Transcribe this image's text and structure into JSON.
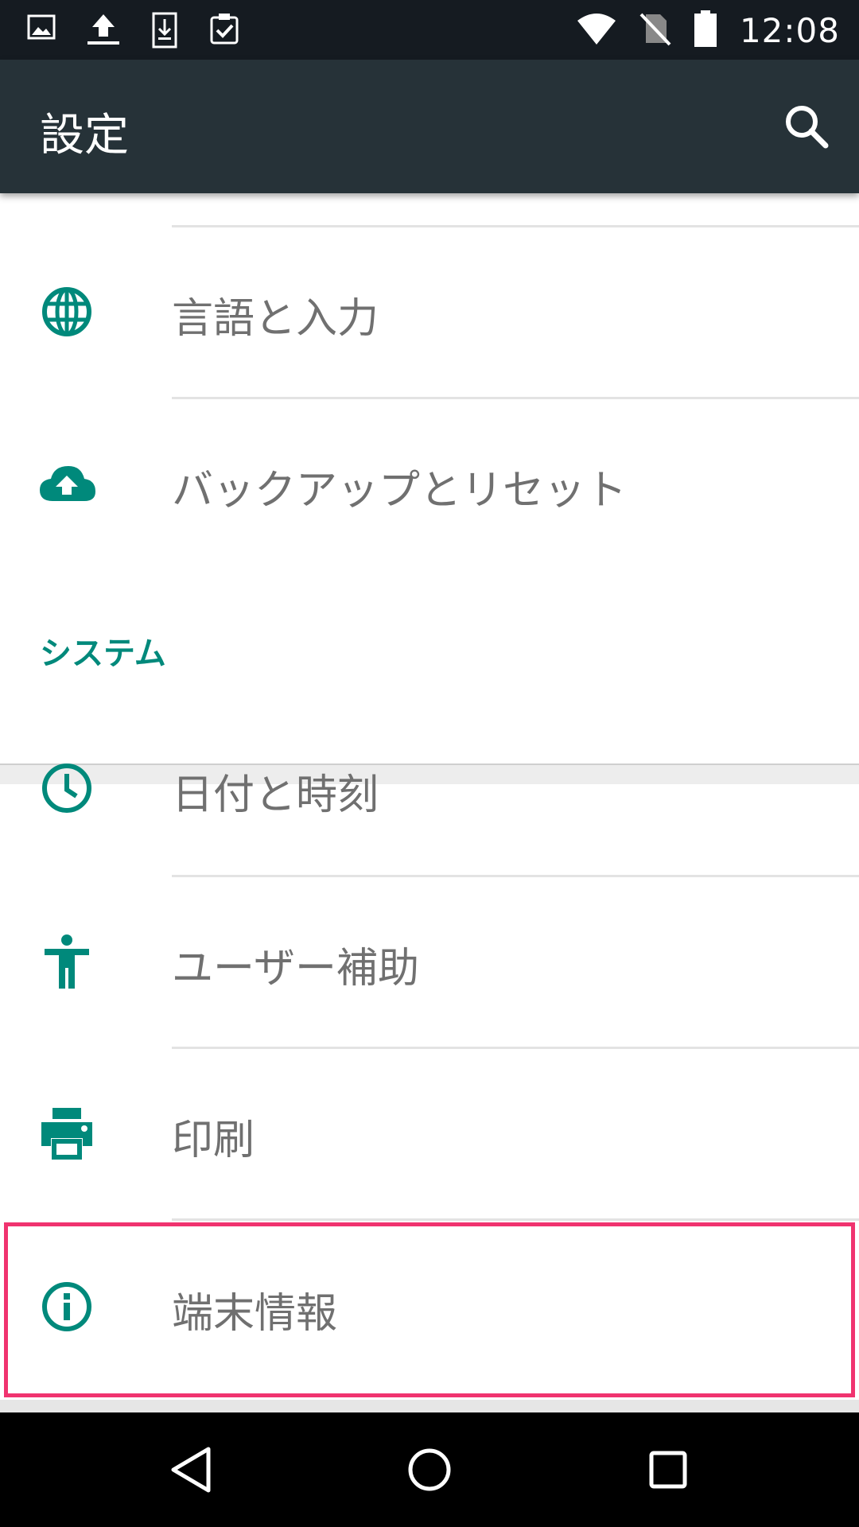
{
  "status_bar": {
    "time": "12:08",
    "icons": [
      "image-icon",
      "upload-icon",
      "download-icon",
      "clipboard-check-icon",
      "wifi-icon",
      "no-sim-icon",
      "battery-icon"
    ]
  },
  "app_bar": {
    "title": "設定",
    "search_icon": "search-icon"
  },
  "items": [
    {
      "label": "言語と入力",
      "icon": "globe-icon"
    },
    {
      "label": "バックアップとリセット",
      "icon": "cloud-upload-icon"
    }
  ],
  "system_section": {
    "header": "システム",
    "items": [
      {
        "label": "日付と時刻",
        "icon": "clock-icon"
      },
      {
        "label": "ユーザー補助",
        "icon": "accessibility-icon"
      },
      {
        "label": "印刷",
        "icon": "printer-icon"
      },
      {
        "label": "端末情報",
        "icon": "info-icon",
        "highlighted": true
      }
    ]
  },
  "nav_bar": {
    "buttons": [
      "back-icon",
      "home-icon",
      "recents-icon"
    ]
  },
  "colors": {
    "status_bar": "#151b21",
    "app_bar": "#263238",
    "accent": "#00897b",
    "label_text": "#707070",
    "highlight_border": "#f0336f"
  }
}
